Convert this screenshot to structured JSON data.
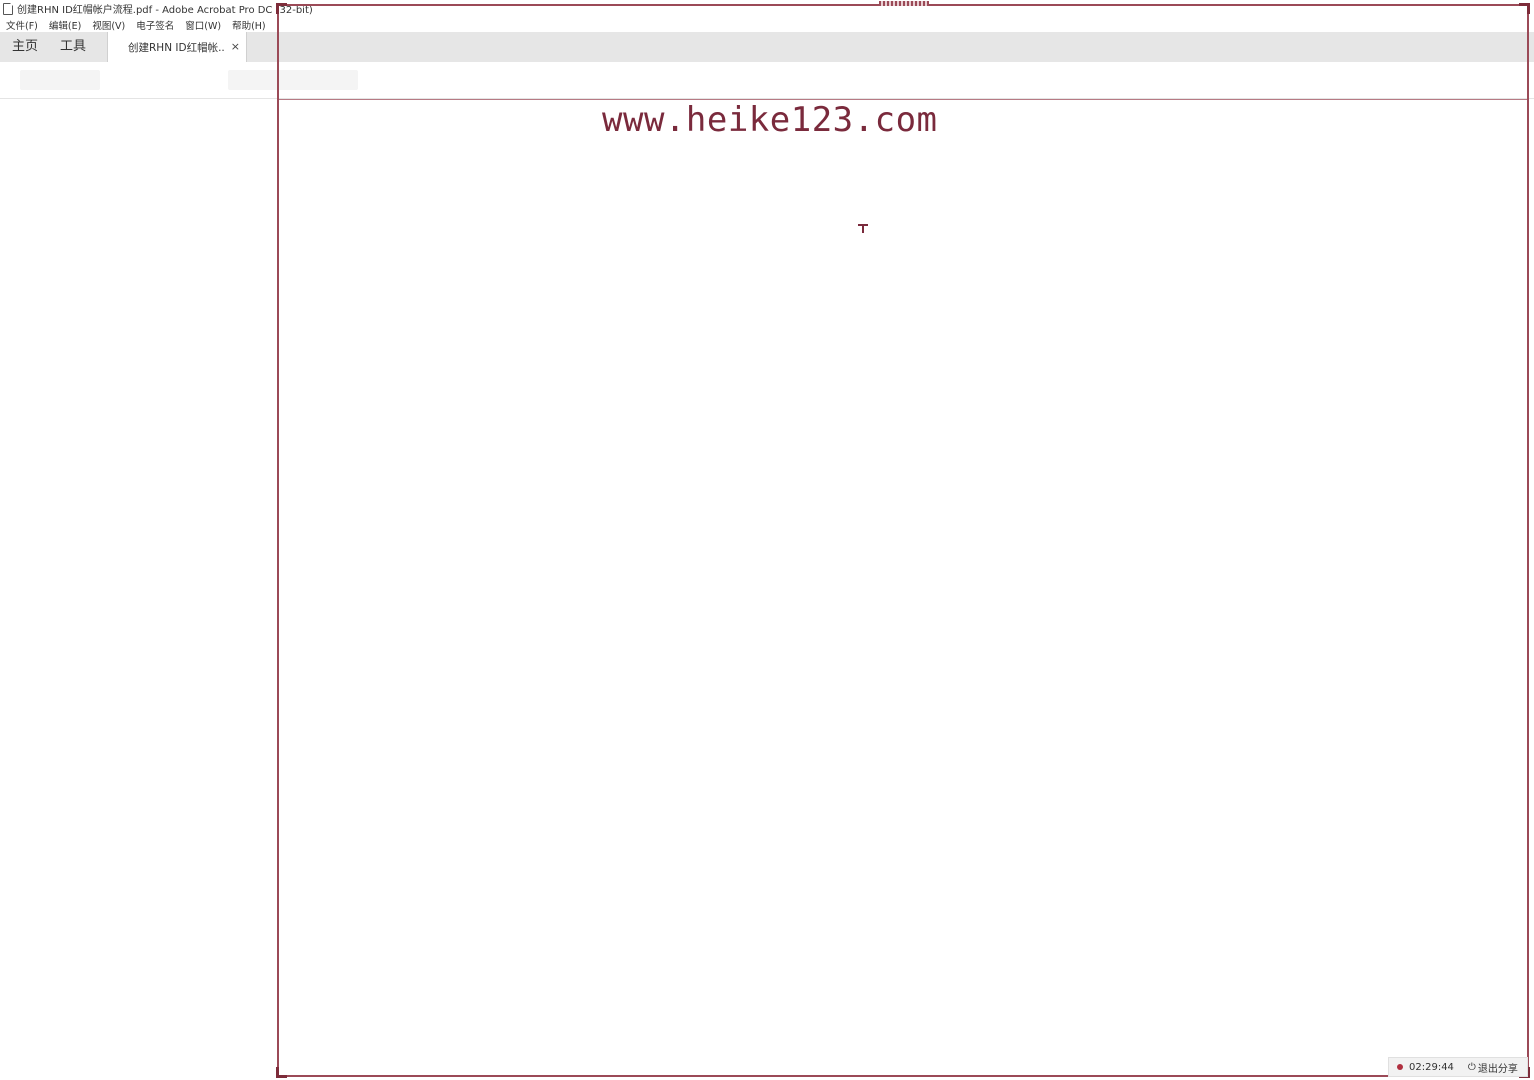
{
  "window": {
    "title": "创建RHN ID红帽帐户流程.pdf - Adobe Acrobat Pro DC (32-bit)"
  },
  "menu": [
    {
      "label": "文件(F)"
    },
    {
      "label": "编辑(E)"
    },
    {
      "label": "视图(V)"
    },
    {
      "label": "电子签名"
    },
    {
      "label": "窗口(W)"
    },
    {
      "label": "帮助(H)"
    }
  ],
  "tabs": {
    "home": "主页",
    "tools": "工具",
    "document": "创建RHN ID红帽帐..",
    "close_glyph": "×"
  },
  "watermark": {
    "text": "www.heike123.com",
    "color": "#7a2a3c"
  },
  "share": {
    "timer": "02:29:44",
    "exit_label": "退出分享",
    "frame_color": "#9b4a57"
  },
  "icons": {
    "app": "pdf-file-icon",
    "cursor": "mouse-cursor-icon",
    "record": "recording-dot-icon",
    "exit": "power-icon"
  }
}
